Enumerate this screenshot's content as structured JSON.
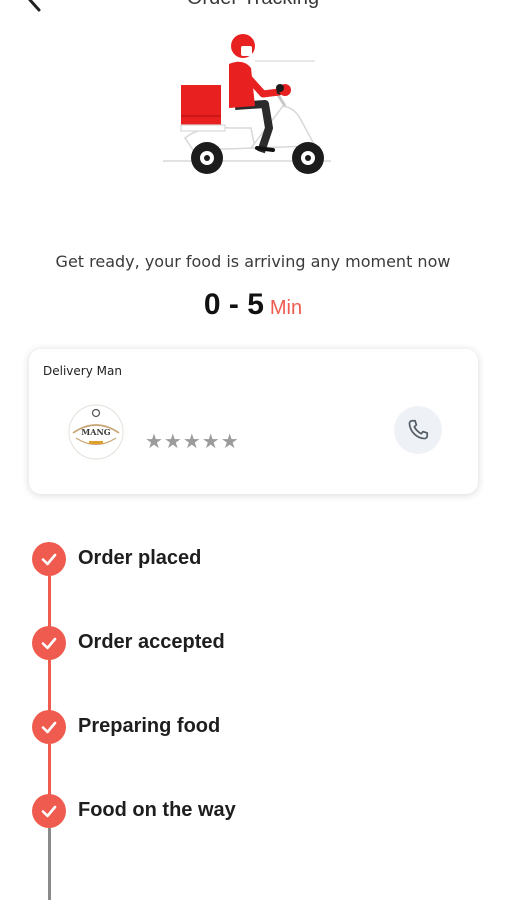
{
  "header": {
    "title": "Order Tracking",
    "back_icon": "chevron-left-icon"
  },
  "eta": {
    "message": "Get ready, your food is arriving any moment now",
    "range": "0 - 5",
    "unit": "Min"
  },
  "delivery_man": {
    "title": "Delivery Man",
    "rating_stars": "★★★★★",
    "rating_value": 0,
    "call_icon": "phone-icon"
  },
  "steps": [
    {
      "label": "Order placed",
      "done": true
    },
    {
      "label": "Order accepted",
      "done": true
    },
    {
      "label": "Preparing food",
      "done": true
    },
    {
      "label": "Food on the way",
      "done": true
    }
  ],
  "colors": {
    "accent": "#ef5b4e",
    "rider_red": "#e82020",
    "pending_line": "#8a8a8a",
    "star_gray": "#9b9b9b"
  }
}
